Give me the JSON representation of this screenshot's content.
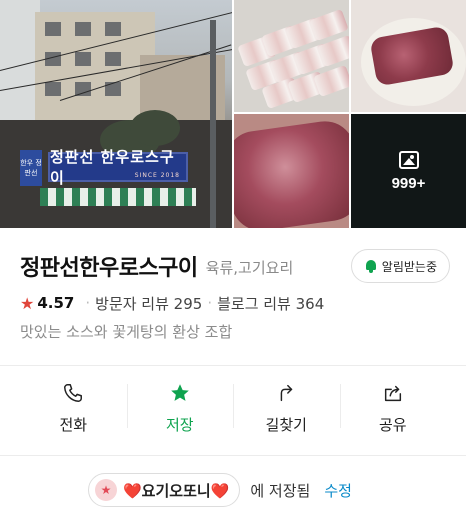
{
  "photos": {
    "main_sign_text": "정판선 한우로스구이",
    "main_sign_since": "SINCE 2018",
    "main_side_text": "한우 정판선",
    "more_count": "999+",
    "more_icon": "image-icon"
  },
  "place": {
    "name": "정판선한우로스구이",
    "category": "육류,고기요리",
    "notify_label": "알림받는중",
    "rating": "4.57",
    "visitor_reviews": "방문자 리뷰 295",
    "blog_reviews": "블로그 리뷰 364",
    "description": "맛있는 소스와 꽃게탕의 환상 조합"
  },
  "actions": [
    {
      "label": "전화",
      "icon": "phone-icon"
    },
    {
      "label": "저장",
      "icon": "star-icon"
    },
    {
      "label": "길찾기",
      "icon": "directions-icon"
    },
    {
      "label": "공유",
      "icon": "share-icon"
    }
  ],
  "saved": {
    "folder_name": "❤️요기오또니❤️",
    "suffix": "에 저장됨",
    "edit_label": "수정"
  },
  "colors": {
    "accent_green": "#0fa34f",
    "rating_star": "#e0453b",
    "link_blue": "#0a8ac9"
  }
}
